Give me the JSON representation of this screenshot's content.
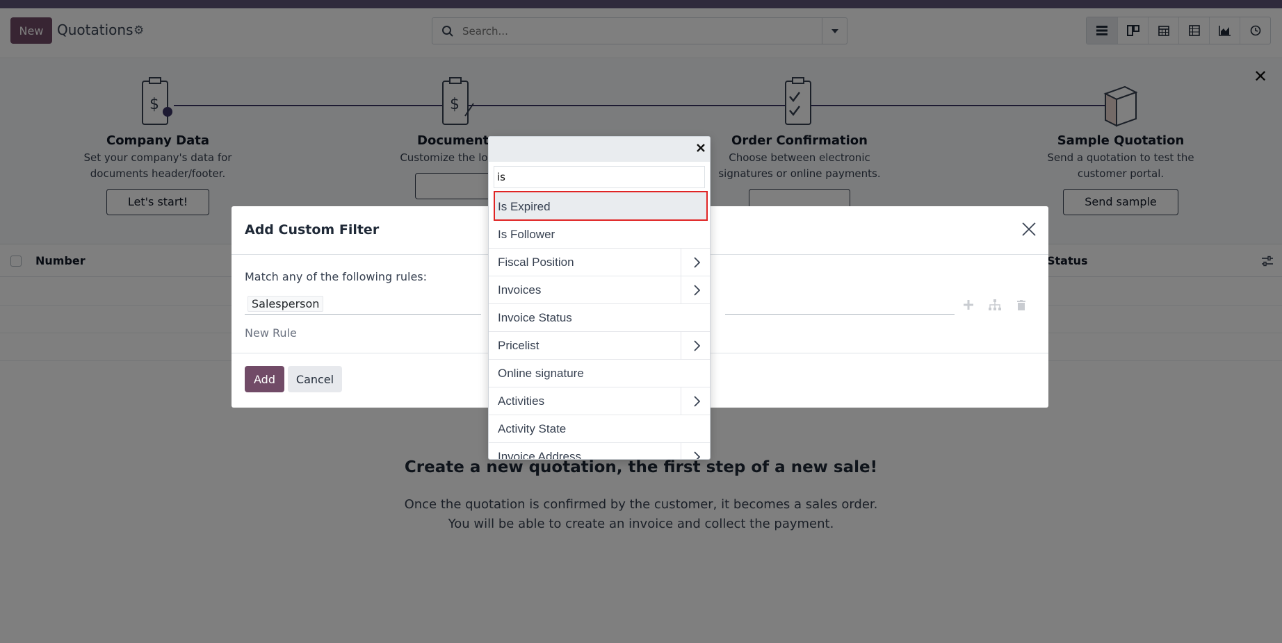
{
  "control_panel": {
    "new_label": "New",
    "title": "Quotations",
    "search_placeholder": "Search...",
    "views": [
      "list-icon",
      "kanban-icon",
      "calendar-icon",
      "pivot-icon",
      "graph-icon",
      "activity-icon"
    ]
  },
  "onboarding": {
    "steps": [
      {
        "title": "Company Data",
        "desc": "Set your company's data for documents header/footer.",
        "button": "Let's start!"
      },
      {
        "title": "Documents",
        "desc": "Customize the look of",
        "button": ""
      },
      {
        "title": "Order Confirmation",
        "desc": "Choose between electronic signatures or online payments.",
        "button": ""
      },
      {
        "title": "Sample Quotation",
        "desc": "Send a quotation to test the customer portal.",
        "button": "Send sample"
      }
    ]
  },
  "list": {
    "col_number": "Number",
    "col_status": "Status"
  },
  "helper": {
    "title": "Create a new quotation, the first step of a new sale!",
    "line1": "Once the quotation is confirmed by the customer, it becomes a sales order.",
    "line2": "You will be able to create an invoice and collect the payment."
  },
  "modal": {
    "title": "Add Custom Filter",
    "match_text": "Match any of the following rules:",
    "rule_path": "Salesperson",
    "new_rule": "New Rule",
    "add_label": "Add",
    "cancel_label": "Cancel"
  },
  "field_selector": {
    "search_value": "is",
    "items": [
      {
        "label": "Is Expired",
        "has_children": false
      },
      {
        "label": "Is Follower",
        "has_children": false
      },
      {
        "label": "Fiscal Position",
        "has_children": true
      },
      {
        "label": "Invoices",
        "has_children": true
      },
      {
        "label": "Invoice Status",
        "has_children": false
      },
      {
        "label": "Pricelist",
        "has_children": true
      },
      {
        "label": "Online signature",
        "has_children": false
      },
      {
        "label": "Activities",
        "has_children": true
      },
      {
        "label": "Activity State",
        "has_children": false
      },
      {
        "label": "Invoice Address",
        "has_children": true
      }
    ]
  },
  "colors": {
    "brand": "#714B67",
    "highlight_border": "#e02424"
  }
}
